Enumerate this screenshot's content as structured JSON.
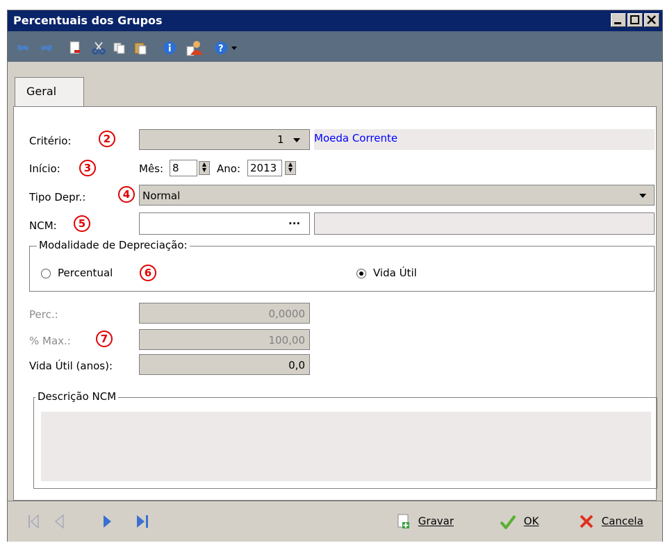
{
  "window": {
    "title": "Percentuais dos Grupos"
  },
  "toolbar": {
    "icons": [
      "undo-icon",
      "redo-icon",
      "new-icon",
      "cut-icon",
      "copy-icon",
      "paste-icon",
      "info-icon",
      "user-icon",
      "help-icon",
      "dropdown-arrow-icon"
    ]
  },
  "tabs": [
    {
      "label": "Geral",
      "active": true
    }
  ],
  "form": {
    "criterio": {
      "label": "Critério:",
      "badge": "2",
      "code": "1",
      "description": "Moeda Corrente"
    },
    "inicio": {
      "label": "Início:",
      "badge": "3",
      "mes_label": "Mês:",
      "mes_value": "8",
      "ano_label": "Ano:",
      "ano_value": "2013"
    },
    "tipo_depr": {
      "label": "Tipo Depr.:",
      "badge": "4",
      "value": "Normal"
    },
    "ncm": {
      "label": "NCM:",
      "badge": "5",
      "value": "",
      "ellipsis": "..."
    },
    "modalidade": {
      "title": "Modalidade de Depreciação:",
      "badge": "6",
      "options": [
        {
          "label": "Percentual",
          "selected": false
        },
        {
          "label": "Vida Útil",
          "selected": true
        }
      ]
    },
    "perc": {
      "label": "Perc.:",
      "value": "0,0000"
    },
    "max": {
      "label": "% Max.:",
      "badge": "7",
      "value": "100,00"
    },
    "vida_util": {
      "label": "Vida Útil (anos):",
      "value": "0,0"
    },
    "descricao_ncm": {
      "title": "Descrição NCM",
      "value": ""
    }
  },
  "bottom": {
    "nav": [
      "first-record-icon",
      "previous-record-icon",
      "next-record-icon",
      "last-record-icon"
    ],
    "gravar_label": "Gravar",
    "ok_label": "OK",
    "cancela_label": "Cancela"
  },
  "colors": {
    "title_bg": "#0a246a",
    "toolbar_bg": "#5b6d80",
    "badge": "#e00000",
    "link_text": "#0000ff"
  }
}
